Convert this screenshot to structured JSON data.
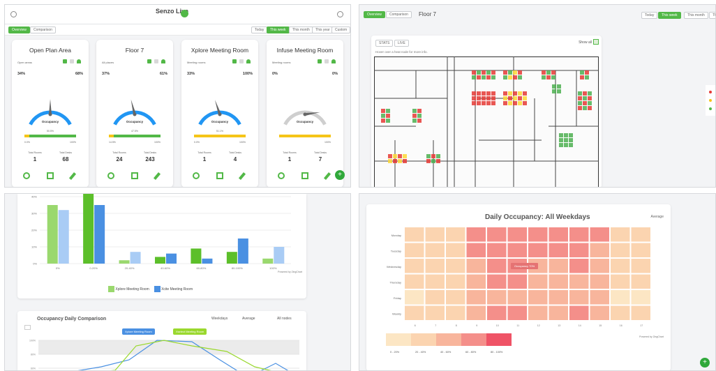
{
  "dashboard": {
    "brand": "Senzo Live",
    "tabs": [
      "Overview",
      "Comparison"
    ],
    "ranges": [
      "Today",
      "This week",
      "This month",
      "This year",
      "Custom"
    ],
    "active_range": "This week",
    "cards": [
      {
        "title": "Open Plan Area",
        "filter": "Open areas",
        "left_pct": "34%",
        "right_pct": "68%",
        "bar_pct": "50.5%",
        "min_label": "0.0%",
        "max_label": "100%",
        "total_label": "Total Rooms",
        "total_value": "1",
        "desks_label": "Total Desks",
        "desks_value": "68",
        "gauge": 0.5,
        "gauge_color": "#2196f3",
        "bar_color": "#52b847"
      },
      {
        "title": "Floor 7",
        "filter": "All places",
        "left_pct": "37%",
        "right_pct": "61%",
        "bar_pct": "47.5%",
        "min_label": "14.5%",
        "max_label": "100%",
        "total_label": "Total Rooms",
        "total_value": "24",
        "desks_label": "Total Desks",
        "desks_value": "243",
        "gauge": 0.44,
        "gauge_color": "#2196f3",
        "bar_color": "#52b847"
      },
      {
        "title": "Xplore Meeting Room",
        "filter": "Meeting rooms",
        "left_pct": "33%",
        "right_pct": "100%",
        "bar_pct": "51.1%",
        "min_label": "0.0%",
        "max_label": "100%",
        "total_label": "Total Rooms",
        "total_value": "1",
        "desks_label": "Total Desks",
        "desks_value": "4",
        "gauge": 0.42,
        "gauge_color": "#2196f3",
        "bar_color": "#f5c518"
      },
      {
        "title": "Infuse Meeting Room",
        "filter": "Meeting rooms",
        "left_pct": "0%",
        "right_pct": "0%",
        "bar_pct": "",
        "min_label": "",
        "max_label": "100%",
        "total_label": "Total Rooms",
        "total_value": "1",
        "desks_label": "Total Desks",
        "desks_value": "7",
        "gauge": 0.85,
        "gauge_color": "#cfcfcf",
        "bar_color": "#f5c518"
      }
    ],
    "gauge_label": "Occupancy"
  },
  "floor": {
    "tabs": [
      "Overview",
      "Comparison"
    ],
    "title": "Floor 7",
    "ranges": [
      "Today",
      "This week",
      "This month",
      "Th"
    ],
    "active_range": "This week",
    "view_tabs": [
      "STATS",
      "LIVE"
    ],
    "show_all": "Show all",
    "hint": "Hover over a heat node for more info."
  },
  "bar_panel": {
    "legend": [
      "Xplore Meeting Room",
      "Xcite Meeting Room"
    ],
    "x_labels": [
      "0%",
      "0-20%",
      "20-40%",
      "40-60%",
      "60-80%",
      "80-100%",
      "100%"
    ],
    "y_labels": [
      "0%",
      "10%",
      "20%",
      "30%",
      "40%"
    ],
    "credit": "Powered by ZingChart"
  },
  "line_panel": {
    "title": "Occupancy Daily Comparison",
    "controls": [
      "Weekdays",
      "Average",
      "All nodes"
    ],
    "tooltips": [
      "Xplore Meeting Room",
      "Xselect Meeting Room"
    ],
    "y_labels": [
      "100%",
      "80%",
      "60%"
    ]
  },
  "heatmap_panel": {
    "title": "Daily Occupancy: All Weekdays",
    "control": "Average",
    "tooltip": "Occupancy 70%",
    "days": [
      "Monday",
      "Tuesday",
      "Wednesday",
      "Thursday",
      "Friday",
      "Weekly"
    ],
    "hours": [
      "6",
      "7",
      "8",
      "9",
      "10",
      "11",
      "12",
      "13",
      "14",
      "15",
      "16",
      "17"
    ],
    "legend": [
      "0 - 20%",
      "20 - 40%",
      "40 - 60%",
      "60 - 80%",
      "80 - 100%"
    ],
    "credit": "Powered by ZingChart"
  },
  "chart_data": [
    {
      "type": "bar",
      "categories": [
        "0%",
        "0-20%",
        "20-40%",
        "40-60%",
        "60-80%",
        "80-100%",
        "100%"
      ],
      "series": [
        {
          "name": "Xplore Meeting Room",
          "values": [
            35,
            42,
            2,
            4,
            9,
            7,
            3
          ]
        },
        {
          "name": "Xcite Meeting Room",
          "values": [
            32,
            35,
            7,
            6,
            3,
            15,
            10
          ]
        }
      ],
      "ylim": [
        0,
        40
      ],
      "colors": [
        "#9ad86e",
        "#a9ccf5"
      ],
      "strong_colors": [
        "#5cbf2a",
        "#4a90e2"
      ]
    },
    {
      "type": "heatmap",
      "rows": [
        "Monday",
        "Tuesday",
        "Wednesday",
        "Thursday",
        "Friday",
        "Weekly"
      ],
      "cols": [
        "6",
        "7",
        "8",
        "9",
        "10",
        "11",
        "12",
        "13",
        "14",
        "15",
        "16",
        "17"
      ],
      "values": [
        [
          25,
          30,
          35,
          60,
          65,
          65,
          60,
          62,
          65,
          60,
          25,
          25
        ],
        [
          20,
          25,
          30,
          60,
          70,
          70,
          62,
          60,
          62,
          55,
          20,
          20
        ],
        [
          22,
          28,
          32,
          58,
          62,
          62,
          55,
          58,
          60,
          55,
          22,
          22
        ],
        [
          20,
          25,
          30,
          55,
          60,
          60,
          55,
          55,
          58,
          52,
          20,
          20
        ],
        [
          18,
          22,
          28,
          50,
          55,
          55,
          52,
          50,
          52,
          45,
          18,
          18
        ],
        [
          20,
          25,
          30,
          55,
          62,
          62,
          57,
          57,
          60,
          53,
          21,
          21
        ]
      ]
    }
  ]
}
